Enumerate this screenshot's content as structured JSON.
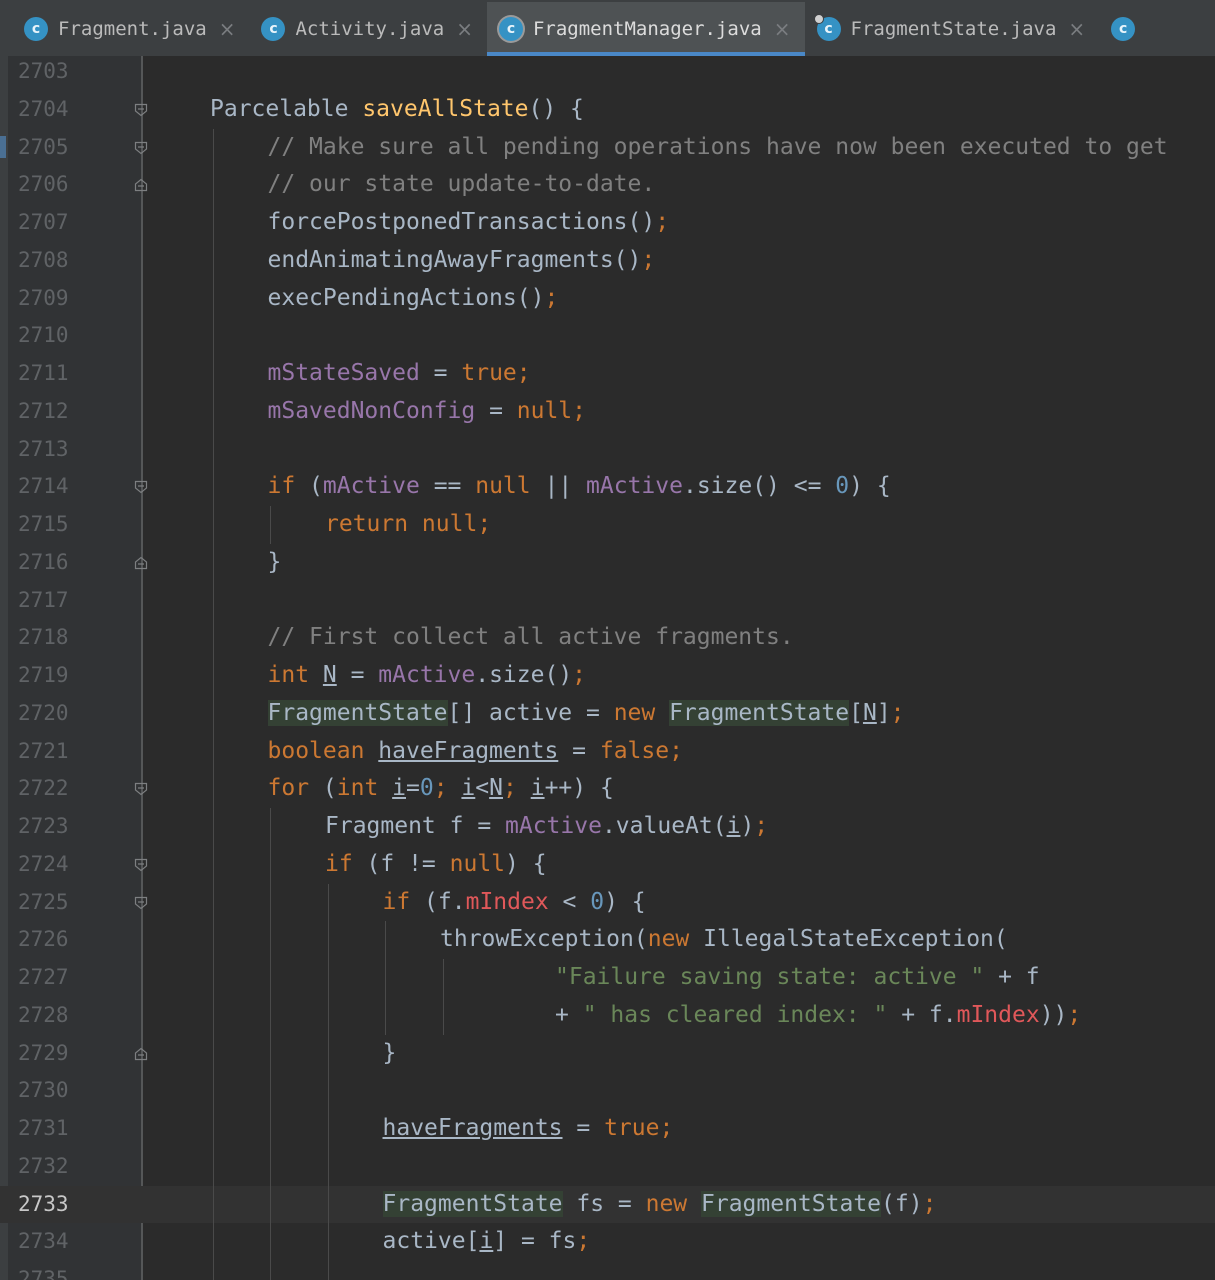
{
  "tabs": [
    {
      "label": "Fragment.java",
      "icon": "class-icon",
      "active": false
    },
    {
      "label": "Activity.java",
      "icon": "class-icon",
      "active": false
    },
    {
      "label": "FragmentManager.java",
      "icon": "class-icon",
      "active": true
    },
    {
      "label": "FragmentState.java",
      "icon": "class-icon",
      "active": false
    }
  ],
  "tab_close_glyph": "×",
  "colors": {
    "keyword": "#cc7832",
    "field": "#9876aa",
    "number": "#6897bb",
    "comment": "#808080",
    "string": "#6a8759",
    "method_decl": "#ffc66d",
    "error_field": "#e0585a",
    "plain": "#a9b7c6",
    "background": "#2b2b2b",
    "active_tab_underline": "#4a88c7"
  },
  "editor": {
    "current_line": "2733",
    "lines": [
      {
        "num": "2703",
        "segs": []
      },
      {
        "num": "2704",
        "segs": [
          [
            "",
            "Parcelable "
          ],
          [
            "fn",
            "saveAllState"
          ],
          [
            "",
            "() {"
          ]
        ]
      },
      {
        "num": "2705",
        "segs": [
          [
            "cmt",
            "// Make sure all pending operations have now been executed to get"
          ]
        ]
      },
      {
        "num": "2706",
        "segs": [
          [
            "cmt",
            "// our state update-to-date."
          ]
        ]
      },
      {
        "num": "2707",
        "segs": [
          [
            "",
            "forcePostponedTransactions()"
          ],
          [
            "kw",
            ";"
          ]
        ]
      },
      {
        "num": "2708",
        "segs": [
          [
            "",
            "endAnimatingAwayFragments()"
          ],
          [
            "kw",
            ";"
          ]
        ]
      },
      {
        "num": "2709",
        "segs": [
          [
            "",
            "execPendingActions()"
          ],
          [
            "kw",
            ";"
          ]
        ]
      },
      {
        "num": "2710",
        "segs": []
      },
      {
        "num": "2711",
        "segs": [
          [
            "fld",
            "mStateSaved"
          ],
          [
            "",
            " = "
          ],
          [
            "kw",
            "true;"
          ]
        ]
      },
      {
        "num": "2712",
        "segs": [
          [
            "fld",
            "mSavedNonConfig"
          ],
          [
            "",
            " = "
          ],
          [
            "kw",
            "null;"
          ]
        ]
      },
      {
        "num": "2713",
        "segs": []
      },
      {
        "num": "2714",
        "segs": [
          [
            "kw",
            "if "
          ],
          [
            "",
            "("
          ],
          [
            "fld",
            "mActive"
          ],
          [
            "",
            " == "
          ],
          [
            "kw",
            "null "
          ],
          [
            "",
            "|| "
          ],
          [
            "fld",
            "mActive"
          ],
          [
            "",
            ".size() <= "
          ],
          [
            "num",
            "0"
          ],
          [
            "",
            ") {"
          ]
        ]
      },
      {
        "num": "2715",
        "segs": [
          [
            "kw",
            "return null;"
          ]
        ]
      },
      {
        "num": "2716",
        "segs": [
          [
            "",
            "}"
          ]
        ]
      },
      {
        "num": "2717",
        "segs": []
      },
      {
        "num": "2718",
        "segs": [
          [
            "cmt",
            "// First collect all active fragments."
          ]
        ]
      },
      {
        "num": "2719",
        "segs": [
          [
            "kw",
            "int "
          ],
          [
            "ul",
            "N"
          ],
          [
            "",
            " = "
          ],
          [
            "fld",
            "mActive"
          ],
          [
            "",
            ".size()"
          ],
          [
            "kw",
            ";"
          ]
        ]
      },
      {
        "num": "2720",
        "segs": [
          [
            "hl",
            "FragmentState"
          ],
          [
            "",
            "[] active = "
          ],
          [
            "kw",
            "new "
          ],
          [
            "hl",
            "FragmentState"
          ],
          [
            "",
            "["
          ],
          [
            "ul",
            "N"
          ],
          [
            "",
            "]"
          ],
          [
            "kw",
            ";"
          ]
        ]
      },
      {
        "num": "2721",
        "segs": [
          [
            "kw",
            "boolean "
          ],
          [
            "ul",
            "haveFragments"
          ],
          [
            "",
            " = "
          ],
          [
            "kw",
            "false;"
          ]
        ]
      },
      {
        "num": "2722",
        "segs": [
          [
            "kw",
            "for "
          ],
          [
            "",
            "("
          ],
          [
            "kw",
            "int "
          ],
          [
            "ul",
            "i"
          ],
          [
            "",
            "="
          ],
          [
            "num",
            "0"
          ],
          [
            "kw",
            "; "
          ],
          [
            "ul",
            "i"
          ],
          [
            "",
            "<"
          ],
          [
            "ul",
            "N"
          ],
          [
            "kw",
            "; "
          ],
          [
            "ul",
            "i"
          ],
          [
            "",
            "++) {"
          ]
        ]
      },
      {
        "num": "2723",
        "segs": [
          [
            "",
            "Fragment f = "
          ],
          [
            "fld",
            "mActive"
          ],
          [
            "",
            ".valueAt("
          ],
          [
            "ul",
            "i"
          ],
          [
            "",
            ")"
          ],
          [
            "kw",
            ";"
          ]
        ]
      },
      {
        "num": "2724",
        "segs": [
          [
            "kw",
            "if "
          ],
          [
            "",
            "(f != "
          ],
          [
            "kw",
            "null"
          ],
          [
            "",
            ") {"
          ]
        ]
      },
      {
        "num": "2725",
        "segs": [
          [
            "kw",
            "if "
          ],
          [
            "",
            "(f."
          ],
          [
            "red",
            "mIndex"
          ],
          [
            "",
            " < "
          ],
          [
            "num",
            "0"
          ],
          [
            "",
            ") {"
          ]
        ]
      },
      {
        "num": "2726",
        "segs": [
          [
            "",
            "throwException("
          ],
          [
            "kw",
            "new "
          ],
          [
            "",
            "IllegalStateException("
          ]
        ]
      },
      {
        "num": "2727",
        "segs": [
          [
            "str",
            "\"Failure saving state: active \""
          ],
          [
            "",
            " + f"
          ]
        ]
      },
      {
        "num": "2728",
        "segs": [
          [
            "",
            "+ "
          ],
          [
            "str",
            "\" has cleared index: \""
          ],
          [
            "",
            " + f."
          ],
          [
            "red",
            "mIndex"
          ],
          [
            "",
            "))"
          ],
          [
            "kw",
            ";"
          ]
        ]
      },
      {
        "num": "2729",
        "segs": [
          [
            "",
            "}"
          ]
        ]
      },
      {
        "num": "2730",
        "segs": []
      },
      {
        "num": "2731",
        "segs": [
          [
            "ul",
            "haveFragments"
          ],
          [
            "",
            " = "
          ],
          [
            "kw",
            "true;"
          ]
        ]
      },
      {
        "num": "2732",
        "segs": []
      },
      {
        "num": "2733",
        "segs": [
          [
            "hl",
            "FragmentState"
          ],
          [
            "",
            " fs = "
          ],
          [
            "kw",
            "new "
          ],
          [
            "hl",
            "FragmentState"
          ],
          [
            "",
            "(f)"
          ],
          [
            "kw",
            ";"
          ]
        ]
      },
      {
        "num": "2734",
        "segs": [
          [
            "",
            "active["
          ],
          [
            "ul",
            "i"
          ],
          [
            "",
            "] = fs"
          ],
          [
            "kw",
            ";"
          ]
        ]
      },
      {
        "num": "2735",
        "segs": []
      }
    ]
  }
}
